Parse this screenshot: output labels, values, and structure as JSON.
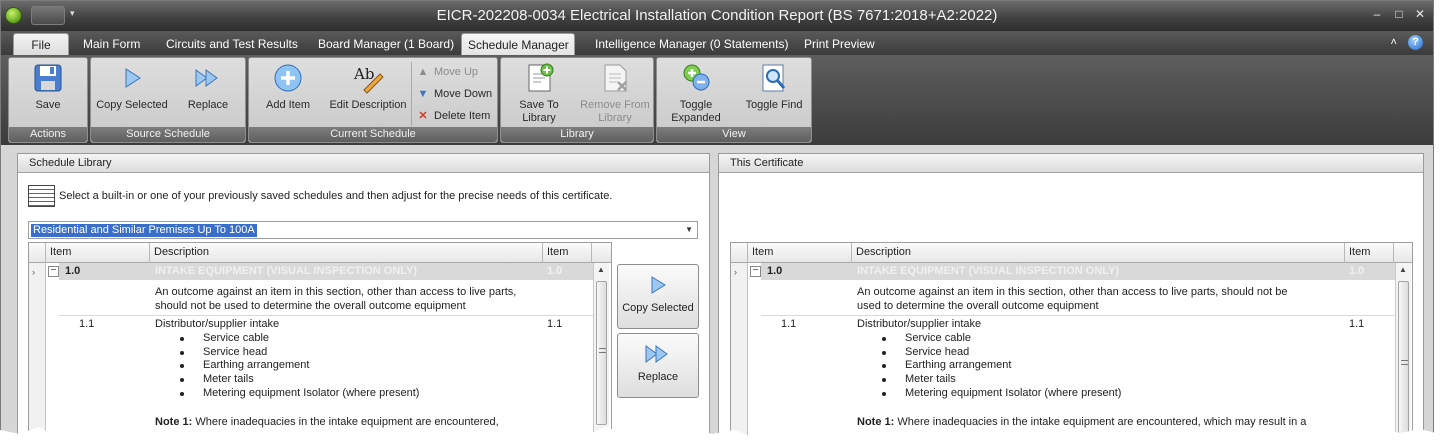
{
  "window": {
    "title": "EICR-202208-0034 Electrical Installation Condition Report (BS 7671:2018+A2:2022)",
    "controls": {
      "minimize": "–",
      "maximize": "□",
      "close": "✕"
    },
    "qat_dropdown": "▾"
  },
  "tabs": {
    "file": "File",
    "main_form": "Main Form",
    "circuits": "Circuits and Test Results",
    "board_manager": "Board Manager (1 Board)",
    "schedule_manager": "Schedule Manager",
    "intelligence": "Intelligence Manager (0 Statements)",
    "print_preview": "Print Preview",
    "collapse_glyph": "˄",
    "help_glyph": "?"
  },
  "ribbon": {
    "actions": {
      "label": "Actions",
      "save": "Save"
    },
    "source": {
      "label": "Source Schedule",
      "copy_selected": "Copy Selected",
      "replace": "Replace"
    },
    "current": {
      "label": "Current Schedule",
      "add_item": "Add Item",
      "edit_description": "Edit Description",
      "move_up": "Move Up",
      "move_down": "Move Down",
      "delete_item": "Delete Item"
    },
    "library": {
      "label": "Library",
      "save_to_1": "Save To",
      "save_to_2": "Library",
      "remove_from_1": "Remove From",
      "remove_from_2": "Library"
    },
    "view": {
      "label": "View",
      "toggle_expanded_1": "Toggle",
      "toggle_expanded_2": "Expanded",
      "toggle_find": "Toggle Find"
    }
  },
  "library_panel": {
    "title": "Schedule Library",
    "instruction": "Select a built-in or one of your previously saved schedules and then adjust for the precise needs of this certificate.",
    "combo_value": "Residential and Similar Premises Up To 100A"
  },
  "certificate_panel": {
    "title": "This Certificate"
  },
  "grid": {
    "columns": {
      "item": "Item",
      "description": "Description",
      "item2": "Item"
    },
    "expander": "−",
    "section": {
      "code": "1.0",
      "title": "INTAKE EQUIPMENT (VISUAL INSPECTION ONLY)",
      "code2": "1.0"
    },
    "outcome_line1_left": "An outcome against an item in this section, other than access to live parts,",
    "outcome_line2_left": "should not be used to determine the overall outcome equipment",
    "outcome_line1_right": "An outcome against an item in this section, other than access to live parts, should not be",
    "outcome_line2_right": "used to determine the overall outcome equipment",
    "item": {
      "code": "1.1",
      "title": "Distributor/supplier intake",
      "bullets": [
        "Service cable",
        "Service head",
        "Earthing arrangement",
        "Meter tails",
        "Metering equipment Isolator (where present)"
      ],
      "code2": "1.1"
    },
    "note_label": "Note 1:",
    "note_left": " Where inadequacies in the intake equipment are encountered,",
    "note_right": " Where inadequacies in the intake equipment are encountered, which may result in a"
  },
  "transfer_buttons": {
    "copy_selected": "Copy Selected",
    "replace": "Replace"
  }
}
